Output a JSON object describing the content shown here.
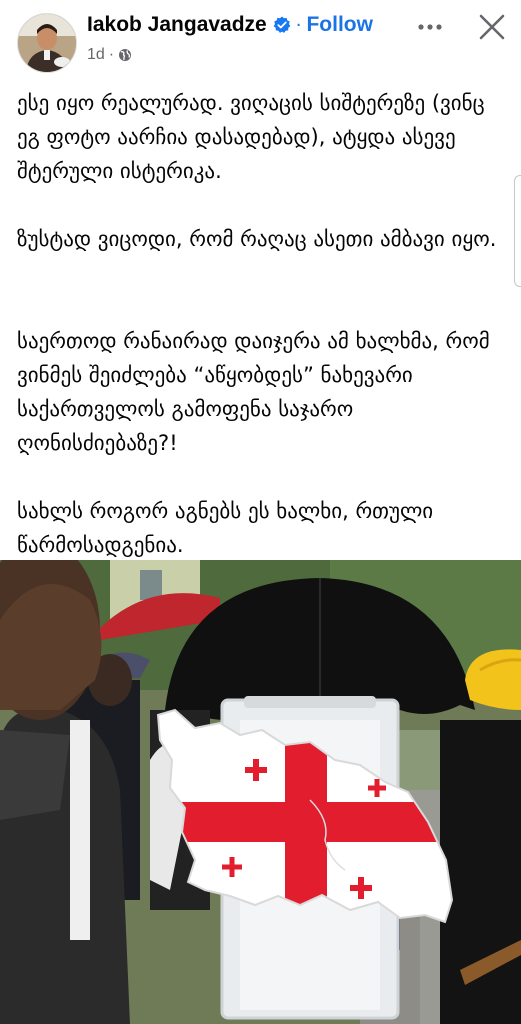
{
  "post": {
    "author": "Iakob Jangavadze",
    "follow_label": "Follow",
    "dot": "·",
    "time": "1d",
    "text": [
      "ესე იყო რეალურად. ვიღაცის სიშტერეზე (ვინც ეგ ფოტო აარჩია დასადებად), ატყდა ასევე შტერული ისტერიკა.",
      "ზუსტად ვიცოდი, რომ რაღაც ასეთი ამბავი იყო.",
      "საერთოდ რანაირად დაიჯერა ამ ხალხმა, რომ ვინმეს შეიძლება “აწყობდეს” ნახევარი საქართველოს გამოფენა საჯარო ღონისძიებაზე?!",
      "სახლს როგორ აგნებს ეს ხალხი, რთული წარმოსადგენია."
    ]
  },
  "icons": {
    "verified": "verified-badge-icon",
    "globe": "globe-icon",
    "more": "more-options-icon",
    "close": "close-icon"
  },
  "colors": {
    "link_blue": "#1b74e4",
    "meta_gray": "#65676b",
    "text": "#050505",
    "flag_red": "#e21d2e",
    "umbrella_red": "#c0262e",
    "umbrella_black": "#101010",
    "umbrella_yellow": "#f1c31b"
  }
}
